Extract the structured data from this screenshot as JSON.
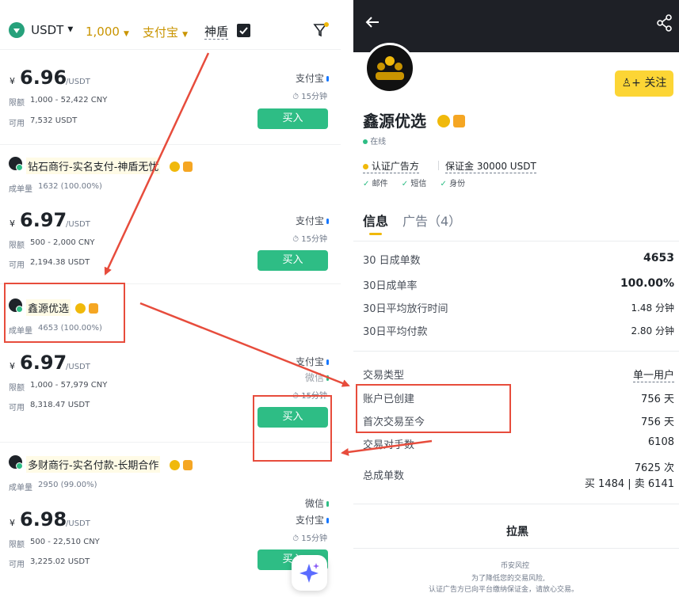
{
  "filter_bar": {
    "coin": "USDT",
    "amount": "1,000",
    "payment": "支付宝",
    "shield_label": "神盾"
  },
  "listings": [
    {
      "price": "6.96",
      "yen": "¥",
      "unit": "/USDT",
      "limit_label": "限额",
      "limit": "1,000 - 52,422 CNY",
      "avail_label": "可用",
      "available": "7,532 USDT",
      "payments": [
        "支付宝"
      ],
      "time": "15分钟",
      "buy": "买入"
    },
    {
      "merchant": "钻石商行-实名支付-神盾无忧",
      "orders_label": "成单量",
      "orders": "1632 (100.00%)",
      "price": "6.97",
      "yen": "¥",
      "unit": "/USDT",
      "limit_label": "限额",
      "limit": "500 - 2,000 CNY",
      "avail_label": "可用",
      "available": "2,194.38 USDT",
      "payments": [
        "支付宝"
      ],
      "time": "15分钟",
      "buy": "买入"
    },
    {
      "merchant": "鑫源优选",
      "orders_label": "成单量",
      "orders": "4653 (100.00%)",
      "price": "6.97",
      "yen": "¥",
      "unit": "/USDT",
      "limit_label": "限额",
      "limit": "1,000 - 57,979 CNY",
      "avail_label": "可用",
      "available": "8,318.47 USDT",
      "payments": [
        "支付宝",
        "微信"
      ],
      "time": "15分钟",
      "buy": "买入"
    },
    {
      "merchant": "多财商行-实名付款-长期合作",
      "orders_label": "成单量",
      "orders": "2950 (99.00%)",
      "price": "6.98",
      "yen": "¥",
      "unit": "/USDT",
      "limit_label": "限额",
      "limit": "500 - 22,510 CNY",
      "avail_label": "可用",
      "available": "3,225.02 USDT",
      "payments": [
        "微信",
        "支付宝"
      ],
      "time": "15分钟",
      "buy": "买入"
    }
  ],
  "profile": {
    "follow": "关注",
    "name": "鑫源优选",
    "status": "在线",
    "verified": "认证广告方",
    "deposit": "保证金 30000 USDT",
    "checks": [
      "邮件",
      "短信",
      "身份"
    ],
    "tabs": [
      "信息",
      "广告（4）"
    ],
    "stats": [
      {
        "label": "30 日成单数",
        "value": "4653"
      },
      {
        "label": "30日成单率",
        "value": "100.00%"
      },
      {
        "label": "30日平均放行时间",
        "value": "1.48 分钟"
      },
      {
        "label": "30日平均付款",
        "value": "2.80 分钟"
      }
    ],
    "details": [
      {
        "label": "交易类型",
        "value": "单一用户"
      },
      {
        "label": "账户已创建",
        "value": "756 天"
      },
      {
        "label": "首次交易至今",
        "value": "756 天"
      },
      {
        "label": "交易对手数",
        "value": "6108"
      }
    ],
    "total_label": "总成单数",
    "total_value": "7625 次",
    "total_split": "买 1484 | 卖 6141",
    "block": "拉黑",
    "risk_title": "币安风控",
    "risk_line1": "为了降低您的交易风险,",
    "risk_line2": "认证广告方已向平台缴纳保证金，请放心交易。"
  },
  "colors": {
    "brand_yellow": "#f0b90b",
    "buy_green": "#2ebd85",
    "highlight_red": "#e74c3c",
    "header_dark": "#1e2026"
  }
}
